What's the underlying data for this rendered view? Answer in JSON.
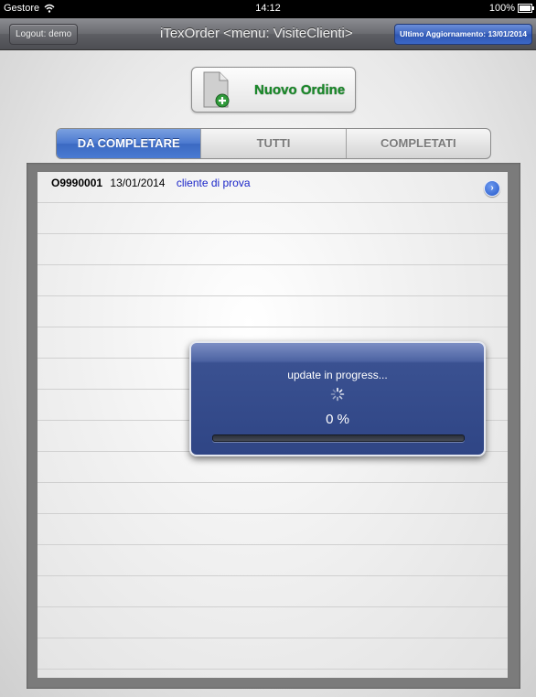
{
  "status_bar": {
    "carrier": "Gestore",
    "time": "14:12",
    "battery": "100%"
  },
  "nav_bar": {
    "logout_label": "Logout: demo",
    "title": "iTexOrder <menu: VisiteClienti>",
    "update_label": "Ultimo Aggiornamento: 13/01/2014"
  },
  "new_order": {
    "label": "Nuovo Ordine",
    "icon": "document-add-icon"
  },
  "tabs": [
    {
      "label": "DA COMPLETARE",
      "active": true
    },
    {
      "label": "TUTTI",
      "active": false
    },
    {
      "label": "COMPLETATI",
      "active": false
    }
  ],
  "orders": [
    {
      "code": "O9990001",
      "date": "13/01/2014",
      "client": "cliente di prova"
    }
  ],
  "progress": {
    "title": "update in progress...",
    "percent_text": "0 %",
    "value": 0.0
  },
  "colors": {
    "accent_blue": "#3b69c2",
    "client_text": "#1a25c8",
    "new_order_green": "#1a8a2a"
  }
}
